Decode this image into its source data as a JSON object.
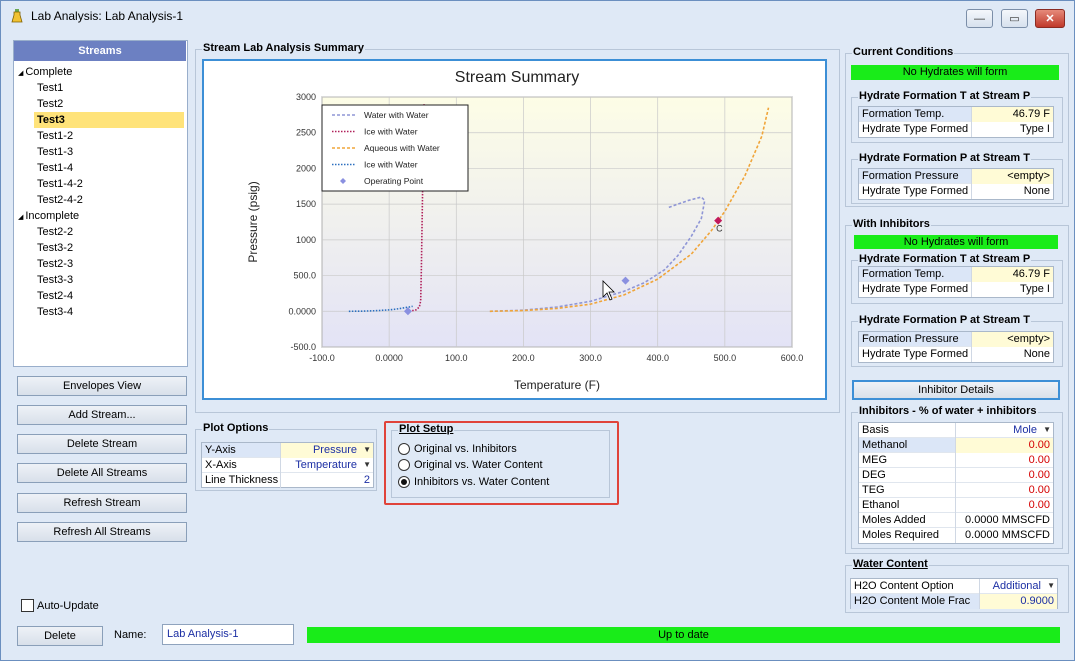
{
  "window": {
    "title": "Lab Analysis: Lab Analysis-1",
    "minimize": "—",
    "maximize": "▭",
    "close": "✕"
  },
  "streams": {
    "header": "Streams",
    "groups": [
      {
        "label": "Complete",
        "items": [
          "Test1",
          "Test2",
          "Test3",
          "Test1-2",
          "Test1-3",
          "Test1-4",
          "Test1-4-2",
          "Test2-4-2"
        ]
      },
      {
        "label": "Incomplete",
        "items": [
          "Test2-2",
          "Test3-2",
          "Test2-3",
          "Test3-3",
          "Test2-4",
          "Test3-4"
        ]
      }
    ],
    "selected": "Test3"
  },
  "left_buttons": {
    "envelopes": "Envelopes View",
    "add": "Add Stream...",
    "delete": "Delete Stream",
    "delete_all": "Delete All Streams",
    "refresh": "Refresh Stream",
    "refresh_all": "Refresh All Streams"
  },
  "auto_update": {
    "label": "Auto-Update",
    "checked": false
  },
  "footer": {
    "delete": "Delete",
    "name_label": "Name:",
    "name_value": "Lab Analysis-1",
    "status": "Up to date"
  },
  "summary": {
    "group_label": "Stream Lab Analysis Summary"
  },
  "chart_data": {
    "type": "line",
    "title": "Stream Summary",
    "xlabel": "Temperature (F)",
    "ylabel": "Pressure (psig)",
    "xlim": [
      -100,
      600
    ],
    "ylim": [
      -500,
      3000
    ],
    "xticks": [
      "-100.0",
      "0.0000",
      "100.0",
      "200.0",
      "300.0",
      "400.0",
      "500.0",
      "600.0"
    ],
    "yticks": [
      "3000",
      "2500",
      "2000",
      "1500",
      "1000",
      "500.0",
      "0.0000",
      "-500.0"
    ],
    "legend_position": "top-left",
    "grid": true,
    "series": [
      {
        "name": "Water with Water",
        "color": "#8f96d6",
        "style": "dashed",
        "x": [
          150,
          200,
          250,
          300,
          350,
          380,
          410,
          430,
          450,
          465,
          470,
          465,
          445,
          415
        ],
        "y": [
          0,
          15,
          60,
          140,
          280,
          400,
          580,
          780,
          1050,
          1300,
          1550,
          1600,
          1550,
          1450
        ]
      },
      {
        "name": "Ice with Water",
        "color": "#b0205a",
        "style": "dotted",
        "x": [
          30,
          40,
          45,
          47,
          48,
          49,
          50,
          51,
          52
        ],
        "y": [
          0,
          20,
          60,
          150,
          600,
          1200,
          1800,
          2400,
          2900
        ]
      },
      {
        "name": "Aqueous with Water",
        "color": "#f0a53a",
        "style": "dashed",
        "x": [
          150,
          200,
          250,
          300,
          350,
          400,
          450,
          480,
          500,
          530,
          555,
          565
        ],
        "y": [
          0,
          10,
          40,
          100,
          230,
          450,
          800,
          1130,
          1400,
          1900,
          2450,
          2850
        ]
      },
      {
        "name": "Ice with Water",
        "color": "#2b6fbf",
        "style": "dotted",
        "x": [
          -60,
          -40,
          -20,
          0,
          10,
          20,
          30,
          35
        ],
        "y": [
          0,
          2,
          8,
          20,
          30,
          45,
          60,
          70
        ]
      },
      {
        "name": "Operating Point",
        "color": "#8a90e0",
        "style": "marker",
        "x": [
          352,
          490,
          28
        ],
        "y": [
          430,
          1270,
          0
        ]
      }
    ],
    "annotations": [
      {
        "text": "C",
        "x": 490,
        "y": 1200
      }
    ]
  },
  "plot_options": {
    "group_label": "Plot Options",
    "rows": [
      {
        "label": "Y-Axis",
        "value": "Pressure",
        "dropdown": true
      },
      {
        "label": "X-Axis",
        "value": "Temperature",
        "dropdown": true
      },
      {
        "label": "Line Thickness",
        "value": "2",
        "dropdown": false
      }
    ]
  },
  "plot_setup": {
    "group_label": "Plot Setup",
    "options": [
      {
        "label": "Original vs. Inhibitors",
        "checked": false
      },
      {
        "label": "Original vs. Water Content",
        "checked": false
      },
      {
        "label": "Inhibitors vs. Water Content",
        "checked": true
      }
    ],
    "highlight_color": "#e0433a"
  },
  "current_conditions": {
    "group_label": "Current Conditions",
    "status": "No Hydrates will form",
    "hydrate_t": {
      "label": "Hydrate Formation T at Stream P",
      "rows": [
        {
          "label": "Formation Temp.",
          "value": "46.79 F"
        },
        {
          "label": "Hydrate Type Formed",
          "value": "Type I"
        }
      ]
    },
    "hydrate_p": {
      "label": "Hydrate Formation P at Stream T",
      "rows": [
        {
          "label": "Formation Pressure",
          "value": "<empty>"
        },
        {
          "label": "Hydrate Type Formed",
          "value": "None"
        }
      ]
    }
  },
  "with_inhibitors": {
    "group_label": "With Inhibitors",
    "status": "No Hydrates will form",
    "hydrate_t": {
      "label": "Hydrate Formation T at Stream P",
      "rows": [
        {
          "label": "Formation Temp.",
          "value": "46.79 F"
        },
        {
          "label": "Hydrate Type Formed",
          "value": "Type I"
        }
      ]
    },
    "hydrate_p": {
      "label": "Hydrate Formation P at Stream T",
      "rows": [
        {
          "label": "Formation Pressure",
          "value": "<empty>"
        },
        {
          "label": "Hydrate Type Formed",
          "value": "None"
        }
      ]
    },
    "details_button": "Inhibitor Details"
  },
  "inhibitors": {
    "group_label": "Inhibitors - % of water + inhibitors",
    "rows": [
      {
        "label": "Basis",
        "value": "Mole"
      },
      {
        "label": "Methanol",
        "value": "0.00"
      },
      {
        "label": "MEG",
        "value": "0.00"
      },
      {
        "label": "DEG",
        "value": "0.00"
      },
      {
        "label": "TEG",
        "value": "0.00"
      },
      {
        "label": "Ethanol",
        "value": "0.00"
      },
      {
        "label": "Moles Added",
        "value": "0.0000 MMSCFD"
      },
      {
        "label": "Moles Required",
        "value": "0.0000 MMSCFD"
      }
    ]
  },
  "water_content": {
    "group_label": "Water Content",
    "rows": [
      {
        "label": "H2O Content Option",
        "value": "Additional"
      },
      {
        "label": "H2O Content Mole Frac",
        "value": "0.9000"
      }
    ]
  },
  "colors": {
    "status_green": "#19ec19",
    "selection": "#ffe37a",
    "streams_header": "#6c80c2"
  }
}
